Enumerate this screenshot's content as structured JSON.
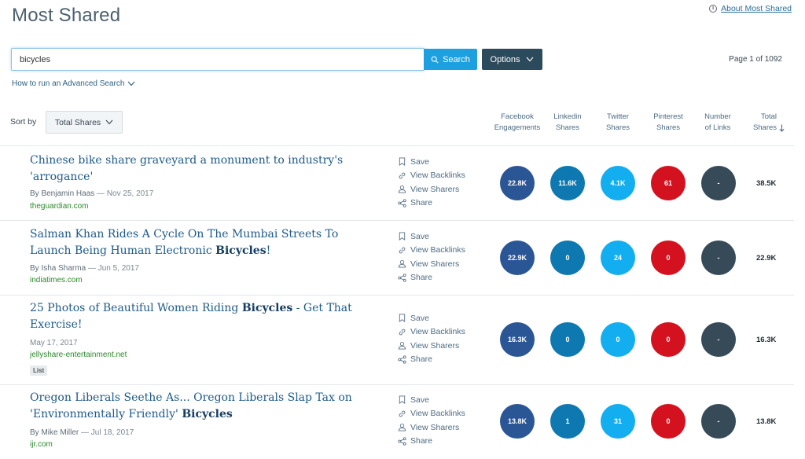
{
  "page": {
    "title": "Most Shared",
    "about_link": "About Most Shared",
    "page_count": "Page 1 of 1092"
  },
  "search": {
    "value": "bicycles",
    "button_label": "Search",
    "options_label": "Options",
    "advanced_link": "How to run an Advanced Search"
  },
  "sort": {
    "label": "Sort by",
    "selected": "Total Shares"
  },
  "columns": {
    "facebook": [
      "Facebook",
      "Engagements"
    ],
    "linkedin": [
      "Linkedin",
      "Shares"
    ],
    "twitter": [
      "Twitter",
      "Shares"
    ],
    "pinterest": [
      "Pinterest",
      "Shares"
    ],
    "links": [
      "Number",
      "of Links"
    ],
    "total": [
      "Total",
      "Shares"
    ]
  },
  "actions": {
    "save": "Save",
    "backlinks": "View Backlinks",
    "sharers": "View Sharers",
    "share": "Share"
  },
  "articles": [
    {
      "title": "Chinese bike share graveyard a monument to industry's 'arrogance'",
      "author": "By Benjamin Haas",
      "date": " — Nov 25, 2017",
      "domain": "theguardian.com",
      "facebook": "22.8K",
      "linkedin": "11.6K",
      "twitter": "4.1K",
      "pinterest": "61",
      "links": "-",
      "total": "38.5K"
    },
    {
      "title_pre": "Salman Khan Rides A Cycle On The Mumbai Streets To Launch Being Human Electronic ",
      "title_bold": "Bicycles",
      "title_post": "!",
      "author": "By Isha Sharma",
      "date": " — Jun 5, 2017",
      "domain": "indiatimes.com",
      "facebook": "22.9K",
      "linkedin": "0",
      "twitter": "24",
      "pinterest": "0",
      "links": "-",
      "total": "22.9K"
    },
    {
      "title_pre": "25 Photos of Beautiful Women Riding ",
      "title_bold": "Bicycles",
      "title_post": " - Get That Exercise!",
      "author": "",
      "date": "May 17, 2017",
      "domain": "jellyshare-entertainment.net",
      "badge": "List",
      "facebook": "16.3K",
      "linkedin": "0",
      "twitter": "0",
      "pinterest": "0",
      "links": "-",
      "total": "16.3K"
    },
    {
      "title_pre": "Oregon Liberals Seethe As... Oregon Liberals Slap Tax on 'Environmentally Friendly' ",
      "title_bold": "Bicycles",
      "title_post": "",
      "author": "By Mike Miller",
      "date": " — Jul 18, 2017",
      "domain": "ijr.com",
      "facebook": "13.8K",
      "linkedin": "1",
      "twitter": "31",
      "pinterest": "0",
      "links": "-",
      "total": "13.8K"
    }
  ],
  "colors": {
    "facebook": "#2b5696",
    "linkedin": "#0e78b0",
    "twitter": "#13aef0",
    "pinterest": "#d4121f",
    "links": "#364a58",
    "search_button": "#1ca0e0",
    "options_button": "#2b4a5c"
  },
  "icons": [
    "info-icon",
    "search-icon",
    "chevron-down-icon",
    "bookmark-icon",
    "link-icon",
    "user-icon",
    "share-icon",
    "sort-arrow-icon"
  ]
}
